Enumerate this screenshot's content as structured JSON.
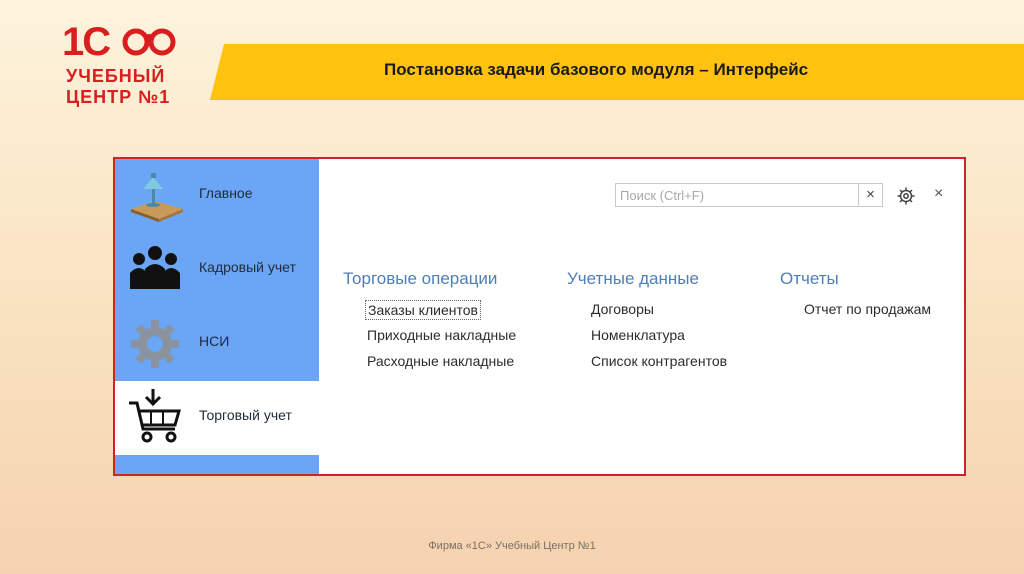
{
  "logo": {
    "big": "1С",
    "line1": "УЧЕБНЫЙ",
    "line2": "ЦЕНТР №1"
  },
  "slide": {
    "title": "Постановка задачи базового модуля – Интерфейс",
    "footer": "Фирма «1С» Учебный Центр №1"
  },
  "colors": {
    "banner": "#ffc20e",
    "panel_border": "#d0222a",
    "sidebar": "#6aa6f5",
    "section_head": "#4d7fb8",
    "logo": "#d81e1e"
  },
  "sidebar": {
    "items": [
      {
        "label": "Главное",
        "icon": "desk-lamp-icon",
        "active": false
      },
      {
        "label": "Кадровый учет",
        "icon": "people-icon",
        "active": false
      },
      {
        "label": "НСИ",
        "icon": "gear-icon",
        "active": false
      },
      {
        "label": "Торговый учет",
        "icon": "cart-icon",
        "active": true
      }
    ]
  },
  "toolbar": {
    "search_placeholder": "Поиск (Ctrl+F)",
    "search_value": "",
    "clear_label": "×",
    "close_label": "×"
  },
  "sections": [
    {
      "title": "Торговые операции",
      "items": [
        "Заказы клиентов",
        "Приходные накладные",
        "Расходные накладные"
      ]
    },
    {
      "title": "Учетные данные",
      "items": [
        "Договоры",
        "Номенклатура",
        "Список контрагентов"
      ]
    },
    {
      "title": "Отчеты",
      "items": [
        "Отчет по продажам"
      ]
    }
  ]
}
